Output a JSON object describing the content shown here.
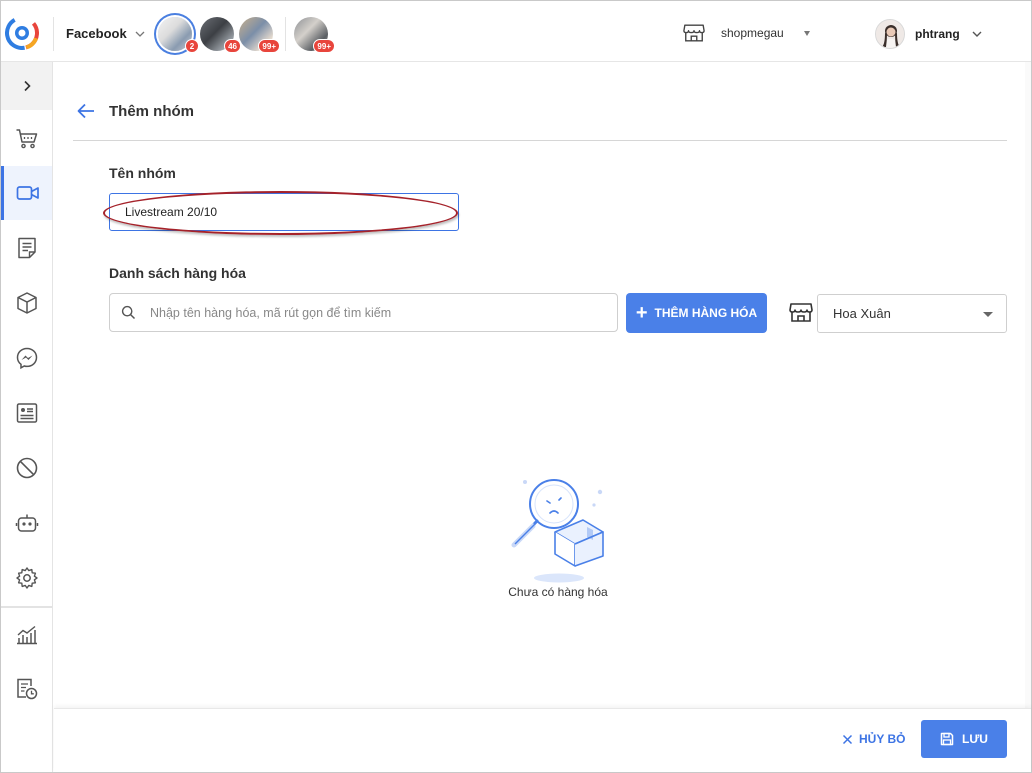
{
  "header": {
    "channel_label": "Facebook",
    "pages": [
      {
        "badge": "2",
        "active": true
      },
      {
        "badge": "46",
        "active": false
      },
      {
        "badge": "99+",
        "active": false
      },
      {
        "badge": "99+",
        "active": false
      }
    ],
    "shop_name": "shopmegau",
    "user_name": "phtrang"
  },
  "sidebar": {
    "items": [
      {
        "icon": "cart-icon",
        "active": false
      },
      {
        "icon": "video-icon",
        "active": true
      },
      {
        "icon": "document-icon",
        "active": false
      },
      {
        "icon": "box-icon",
        "active": false
      },
      {
        "icon": "messenger-icon",
        "active": false
      },
      {
        "icon": "profile-card-icon",
        "active": false
      },
      {
        "icon": "block-icon",
        "active": false
      },
      {
        "icon": "robot-icon",
        "active": false
      },
      {
        "icon": "gear-icon",
        "active": false
      },
      {
        "icon": "chart-icon",
        "active": false
      },
      {
        "icon": "report-history-icon",
        "active": false
      }
    ]
  },
  "page": {
    "title": "Thêm nhóm",
    "group_name_label": "Tên nhóm",
    "group_name_value": "Livestream 20/10",
    "products_label": "Danh sách hàng hóa",
    "search_placeholder": "Nhập tên hàng hóa, mã rút gọn để tìm kiếm",
    "add_button_label": "THÊM HÀNG HÓA",
    "store_selected": "Hoa Xuân",
    "empty_text": "Chưa có hàng hóa"
  },
  "footer": {
    "cancel_label": "HỦY BỎ",
    "save_label": "LƯU"
  },
  "colors": {
    "accent": "#4a80e8",
    "annotation": "#a5222a",
    "badge": "#e8453c"
  }
}
